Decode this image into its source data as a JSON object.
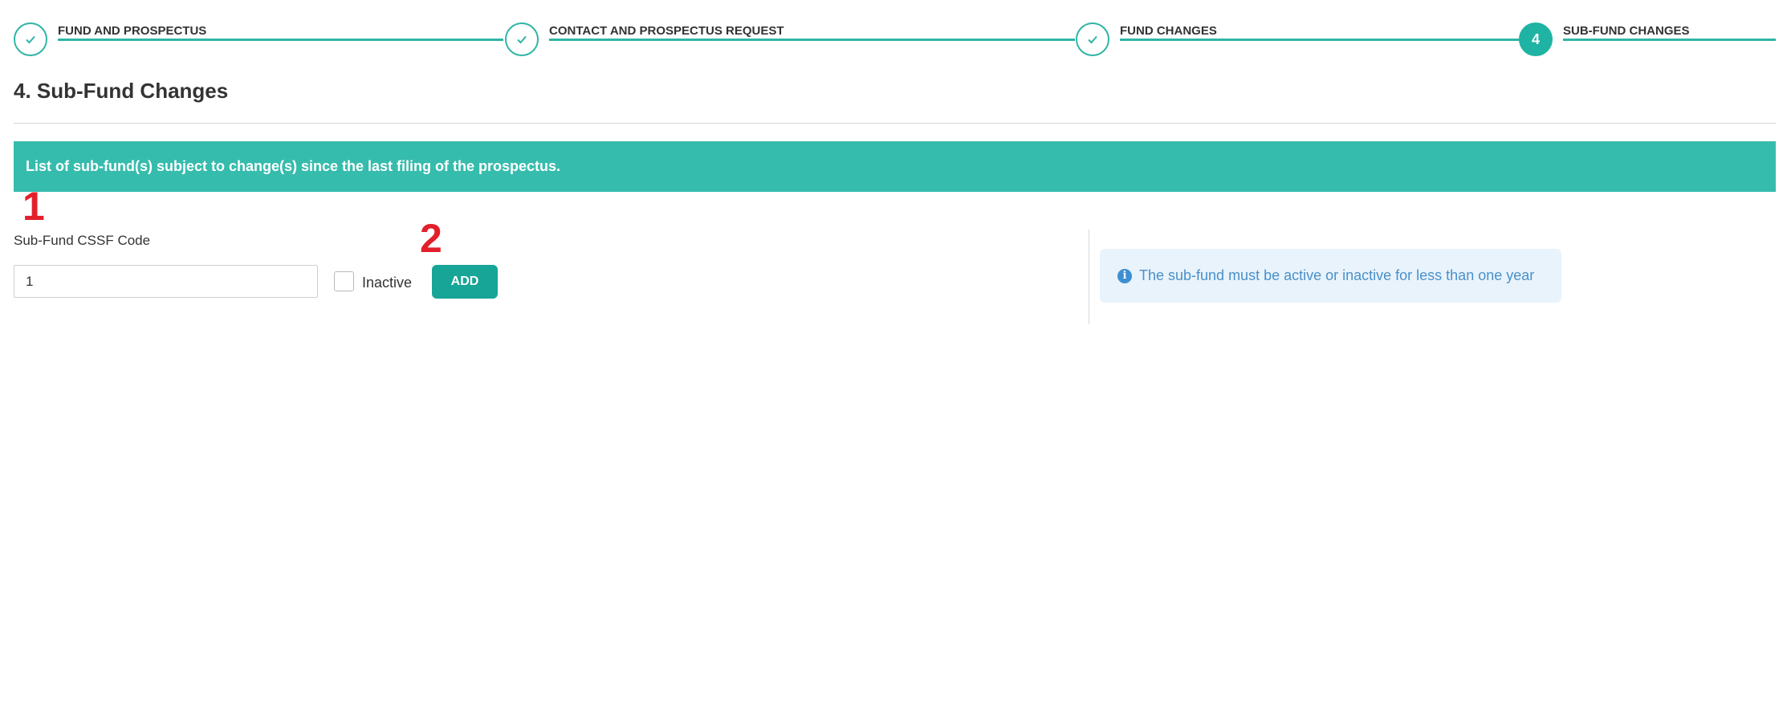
{
  "stepper": {
    "steps": [
      {
        "label": "FUND AND PROSPECTUS",
        "state": "completed",
        "icon": "check-icon"
      },
      {
        "label": "CONTACT AND PROSPECTUS REQUEST",
        "state": "completed",
        "icon": "check-icon"
      },
      {
        "label": "FUND CHANGES",
        "state": "completed",
        "icon": "check-icon"
      },
      {
        "label": "SUB-FUND CHANGES",
        "state": "active",
        "number": "4"
      }
    ]
  },
  "page": {
    "title": "4. Sub-Fund Changes",
    "banner_text": "List of sub-fund(s) subject to change(s) since the last filing of the prospectus."
  },
  "annotations": {
    "marker_1": "1",
    "marker_2": "2"
  },
  "form": {
    "code_label": "Sub-Fund CSSF Code",
    "code_value": "1",
    "inactive_label": "Inactive",
    "inactive_checked": false,
    "add_label": "ADD"
  },
  "info": {
    "icon": "info-icon",
    "message": "The sub-fund must be active or inactive for less than one year"
  },
  "colors": {
    "accent": "#2fb5a5",
    "banner": "#36bcad",
    "button": "#16a597",
    "marker": "#e3202a",
    "info_bg": "#e8f3fc",
    "info_text": "#4a90c8"
  }
}
